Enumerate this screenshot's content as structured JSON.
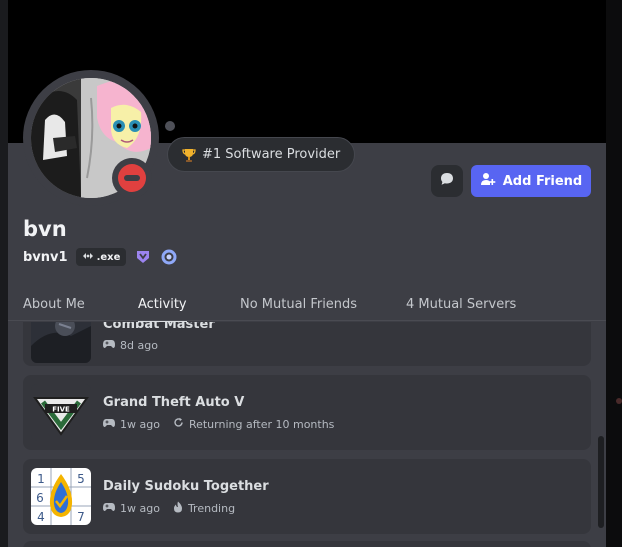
{
  "profile": {
    "display_name": "bvn",
    "username": "bvnv1",
    "clan_tag": ".exe",
    "custom_status": "#1 Software Provider",
    "status_color": "#e0403f"
  },
  "actions": {
    "message_icon": "chat-bubble-icon",
    "add_friend_label": "Add Friend",
    "add_friend_color": "#5865f2"
  },
  "badges": [
    "hypesquad-badge-icon",
    "quest-badge-icon"
  ],
  "tabs": [
    {
      "label": "About Me",
      "active": false
    },
    {
      "label": "Activity",
      "active": true
    },
    {
      "label": "No Mutual Friends",
      "active": false
    },
    {
      "label": "4 Mutual Servers",
      "active": false
    }
  ],
  "activities": [
    {
      "title": "Combat Master",
      "time": "8d ago",
      "extra": ""
    },
    {
      "title": "Grand Theft Auto V",
      "time": "1w ago",
      "extra": "Returning after 10 months"
    },
    {
      "title": "Daily Sudoku Together",
      "time": "1w ago",
      "extra": "Trending"
    }
  ],
  "sudoku": [
    "1",
    "5",
    "6",
    "4",
    "7"
  ]
}
